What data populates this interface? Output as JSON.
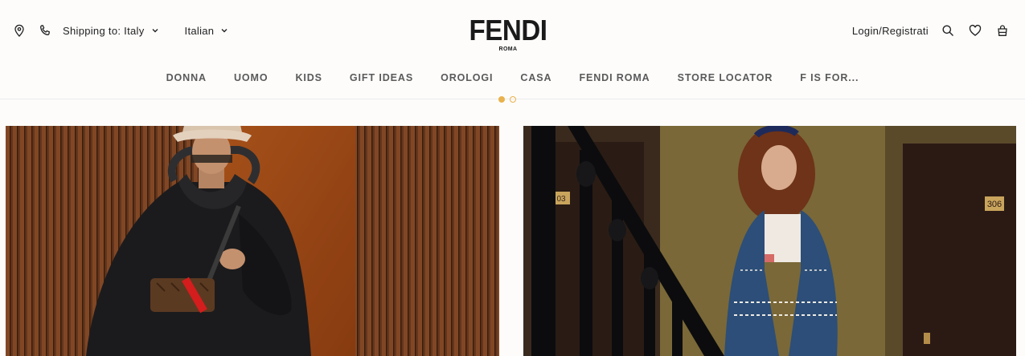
{
  "header": {
    "shipping_label": "Shipping to: Italy",
    "language_label": "Italian",
    "login_label": "Login/Registrati",
    "logo": {
      "brand": "FENDI",
      "subline": "ROMA"
    }
  },
  "nav": {
    "items": [
      "DONNA",
      "UOMO",
      "KIDS",
      "GIFT IDEAS",
      "OROLOGI",
      "CASA",
      "FENDI ROMA",
      "STORE LOCATOR",
      "F IS FOR..."
    ]
  },
  "carousel": {
    "slide_count": 2,
    "active_index": 0
  },
  "hero": {
    "right_panel_room_number": "306",
    "left_panel_room_number": "03"
  },
  "colors": {
    "accent": "#e9b24c",
    "nav_text": "#5a5a5a",
    "background": "#fdfcfb"
  },
  "icons": [
    "location-pin-icon",
    "phone-icon",
    "chevron-down-icon",
    "search-icon",
    "heart-icon",
    "shopping-bag-icon"
  ]
}
